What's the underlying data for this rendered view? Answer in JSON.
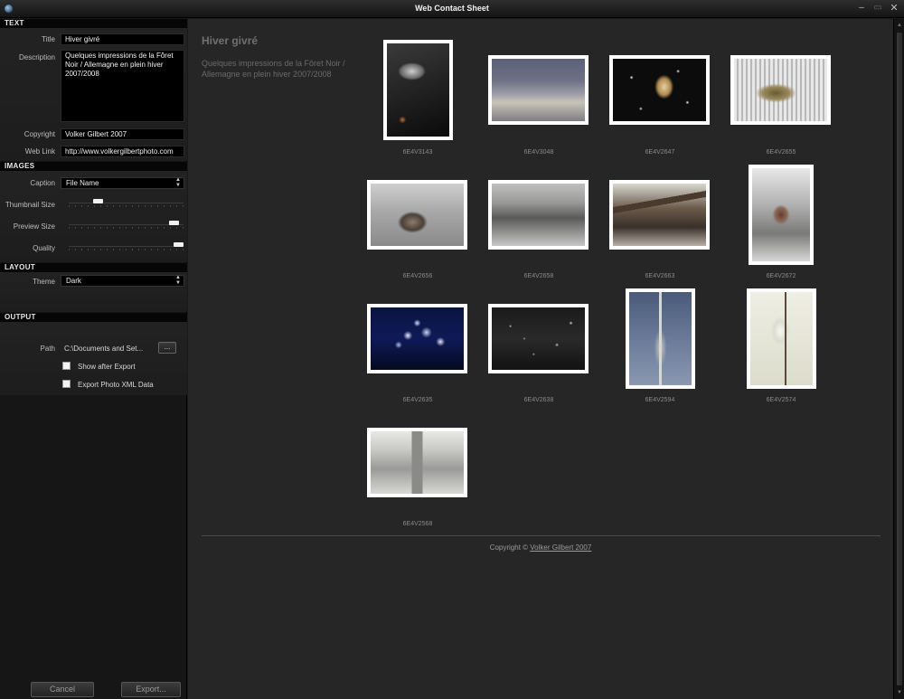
{
  "window": {
    "title": "Web Contact Sheet",
    "minimize": "–",
    "maximize": "▭",
    "close": "✕"
  },
  "text_section": {
    "header": "TEXT",
    "title_label": "Title",
    "title_value": "Hiver givré",
    "description_label": "Description",
    "description_value": "Quelques impressions de la  Fôret Noir / Allemagne en plein hiver 2007/2008",
    "copyright_label": "Copyright",
    "copyright_value": "Volker Gilbert 2007",
    "weblink_label": "Web Link",
    "weblink_value": "http://www.volkergilbertphoto.com"
  },
  "images_section": {
    "header": "IMAGES",
    "caption_label": "Caption",
    "caption_value": "File Name",
    "thumbnail_size_label": "Thumbnail Size",
    "thumbnail_size_level": 0.23,
    "preview_size_label": "Preview Size",
    "preview_size_level": 0.96,
    "quality_label": "Quality",
    "quality_level": 1.0
  },
  "layout_section": {
    "header": "LAYOUT",
    "theme_label": "Theme",
    "theme_value": "Dark"
  },
  "output_section": {
    "header": "OUTPUT",
    "path_label": "Path",
    "path_value": "C:\\Documents and Set...",
    "browse_label": "...",
    "show_after_export_label": "Show after Export",
    "show_after_export_checked": false,
    "export_xml_label": "Export Photo XML Data",
    "export_xml_checked": false
  },
  "buttons": {
    "cancel": "Cancel",
    "export": "Export..."
  },
  "gallery": {
    "title": "Hiver givré",
    "description": "Quelques impressions de la  Fôret Noir / Allemagne en plein hiver 2007/2008",
    "photos": [
      {
        "caption": "6E4V3143"
      },
      {
        "caption": "6E4V3048"
      },
      {
        "caption": "6E4V2647"
      },
      {
        "caption": "6E4V2655"
      },
      {
        "caption": "6E4V2656"
      },
      {
        "caption": "6E4V2658"
      },
      {
        "caption": "6E4V2663"
      },
      {
        "caption": "6E4V2672"
      },
      {
        "caption": "6E4V2635"
      },
      {
        "caption": "6E4V2638"
      },
      {
        "caption": "6E4V2594"
      },
      {
        "caption": "6E4V2574"
      },
      {
        "caption": "6E4V2568"
      }
    ],
    "footer_prefix": "Copyright © ",
    "footer_link": "Volker Gilbert 2007"
  },
  "scrollbar": {
    "up": "▲",
    "down": "▼"
  }
}
